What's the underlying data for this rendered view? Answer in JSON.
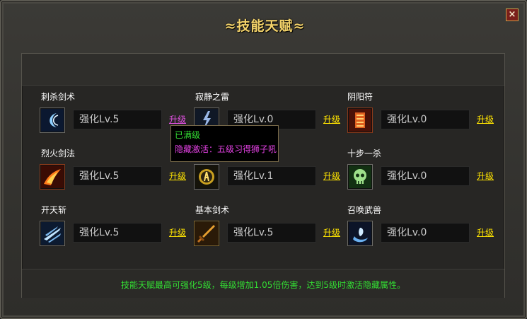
{
  "window": {
    "title": "≈技能天赋≈",
    "close_label": "×"
  },
  "skills": [
    {
      "name": "刺杀剑术",
      "level": "强化Lv.5",
      "upgrade": "升级",
      "icon": "crescent-slash-icon"
    },
    {
      "name": "寂静之雷",
      "level": "强化Lv.0",
      "upgrade": "升级",
      "icon": "lightning-icon"
    },
    {
      "name": "阴阳符",
      "level": "强化Lv.0",
      "upgrade": "升级",
      "icon": "talisman-icon"
    },
    {
      "name": "烈火剑法",
      "level": "强化Lv.5",
      "upgrade": "升级",
      "icon": "fire-slash-icon"
    },
    {
      "name": "",
      "level": "强化Lv.1",
      "upgrade": "升级",
      "icon": "golden-rune-icon"
    },
    {
      "name": "十步一杀",
      "level": "强化Lv.0",
      "upgrade": "升级",
      "icon": "skull-icon"
    },
    {
      "name": "开天斩",
      "level": "强化Lv.5",
      "upgrade": "升级",
      "icon": "wind-blade-icon"
    },
    {
      "name": "基本剑术",
      "level": "强化Lv.5",
      "upgrade": "升级",
      "icon": "sword-icon"
    },
    {
      "name": "召唤武兽",
      "level": "强化Lv.0",
      "upgrade": "升级",
      "icon": "summon-vortex-icon"
    }
  ],
  "tooltip": {
    "line1": "已满级",
    "line2": "隐藏激活：五级习得狮子吼"
  },
  "footer": {
    "text": "技能天赋最高可强化5级，每级增加1.05倍伤害，达到5级时激活隐藏属性。"
  },
  "colors": {
    "title": "#f3d26a",
    "upgrade_link": "#ffe400",
    "upgrade_link_hover": "#e050e0",
    "footer_text": "#33dd33",
    "tooltip_maxed": "#33dd33",
    "tooltip_hidden": "#e040e0"
  }
}
